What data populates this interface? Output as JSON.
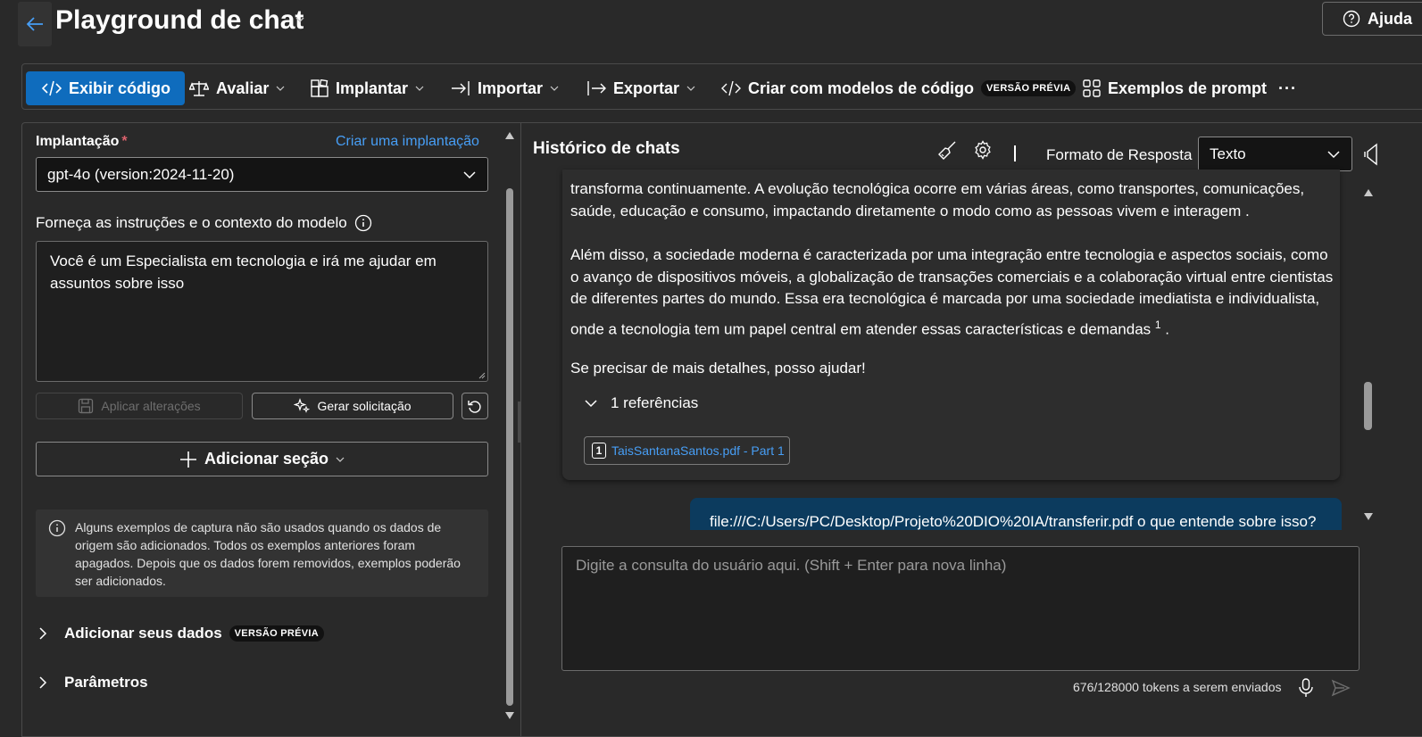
{
  "header": {
    "title": "Playground de chat",
    "help_label": "Ajuda"
  },
  "toolbar": {
    "view_code": "Exibir código",
    "evaluate": "Avaliar",
    "deploy": "Implantar",
    "import": "Importar",
    "export": "Exportar",
    "create_code": "Criar com modelos de código",
    "create_code_tag": "VERSÃO PRÉVIA",
    "prompt_examples": "Exemplos de prompt",
    "more": "···"
  },
  "setup": {
    "deployment_label": "Implantação",
    "required_mark": "*",
    "create_deployment_link": "Criar uma implantação",
    "deployment_value": "gpt-4o (version:2024-11-20)",
    "instructions_label": "Forneça as instruções e o contexto do modelo",
    "instructions_value": "Você é um Especialista em tecnologia e irá me ajudar em assuntos sobre isso",
    "apply_label": "Aplicar alterações",
    "generate_label": "Gerar solicitação",
    "add_section_label": "Adicionar seção",
    "info_text": "Alguns exemplos de captura não são usados quando os dados de origem são adicionados. Todos os exemplos anteriores foram apagados. Depois que os dados forem removidos, exemplos poderão ser adicionados.",
    "add_data_label": "Adicionar seus dados",
    "add_data_tag": "VERSÃO PRÉVIA",
    "params_label": "Parâmetros"
  },
  "chat": {
    "title": "Histórico de chats",
    "response_format_label": "Formato de Resposta",
    "response_format_value": "Texto",
    "assistant_lines": [
      "transforma continuamente. A evolução tecnológica ocorre em várias áreas, como transportes, comunicações,",
      "saúde, educação e consumo, impactando diretamente o modo como as pessoas vivem e interagem ."
    ],
    "assistant_para2_lines": [
      "Além disso, a sociedade moderna é caracterizada por uma integração entre tecnologia e aspectos sociais, como",
      "o avanço de dispositivos móveis, a globalização de transações comerciais e a colaboração virtual entre cientistas",
      "de diferentes partes do mundo. Essa era tecnológica é marcada por uma sociedade imediatista e individualista,"
    ],
    "assistant_para2_last": "onde a tecnologia tem um papel central em atender essas características e demandas",
    "citation_sup": "1",
    "assistant_para2_end": " .",
    "assistant_closing": "Se precisar de mais detalhes, posso ajudar!",
    "references_label": "1 referências",
    "reference_number": "1",
    "reference_file": "TaisSantanaSantos.pdf - Part 1",
    "user_message": "file:///C:/Users/PC/Desktop/Projeto%20DIO%20IA/transferir.pdf o que entende sobre isso?",
    "input_placeholder": "Digite a consulta do usuário aqui. (Shift + Enter para nova linha)",
    "tokens_text": "676/128000 tokens a serem enviados"
  },
  "colors": {
    "background": "#292929",
    "accent": "#0f6cbd",
    "link": "#479ef5",
    "user_bubble": "#0c3b5e",
    "required": "#dc626d"
  }
}
